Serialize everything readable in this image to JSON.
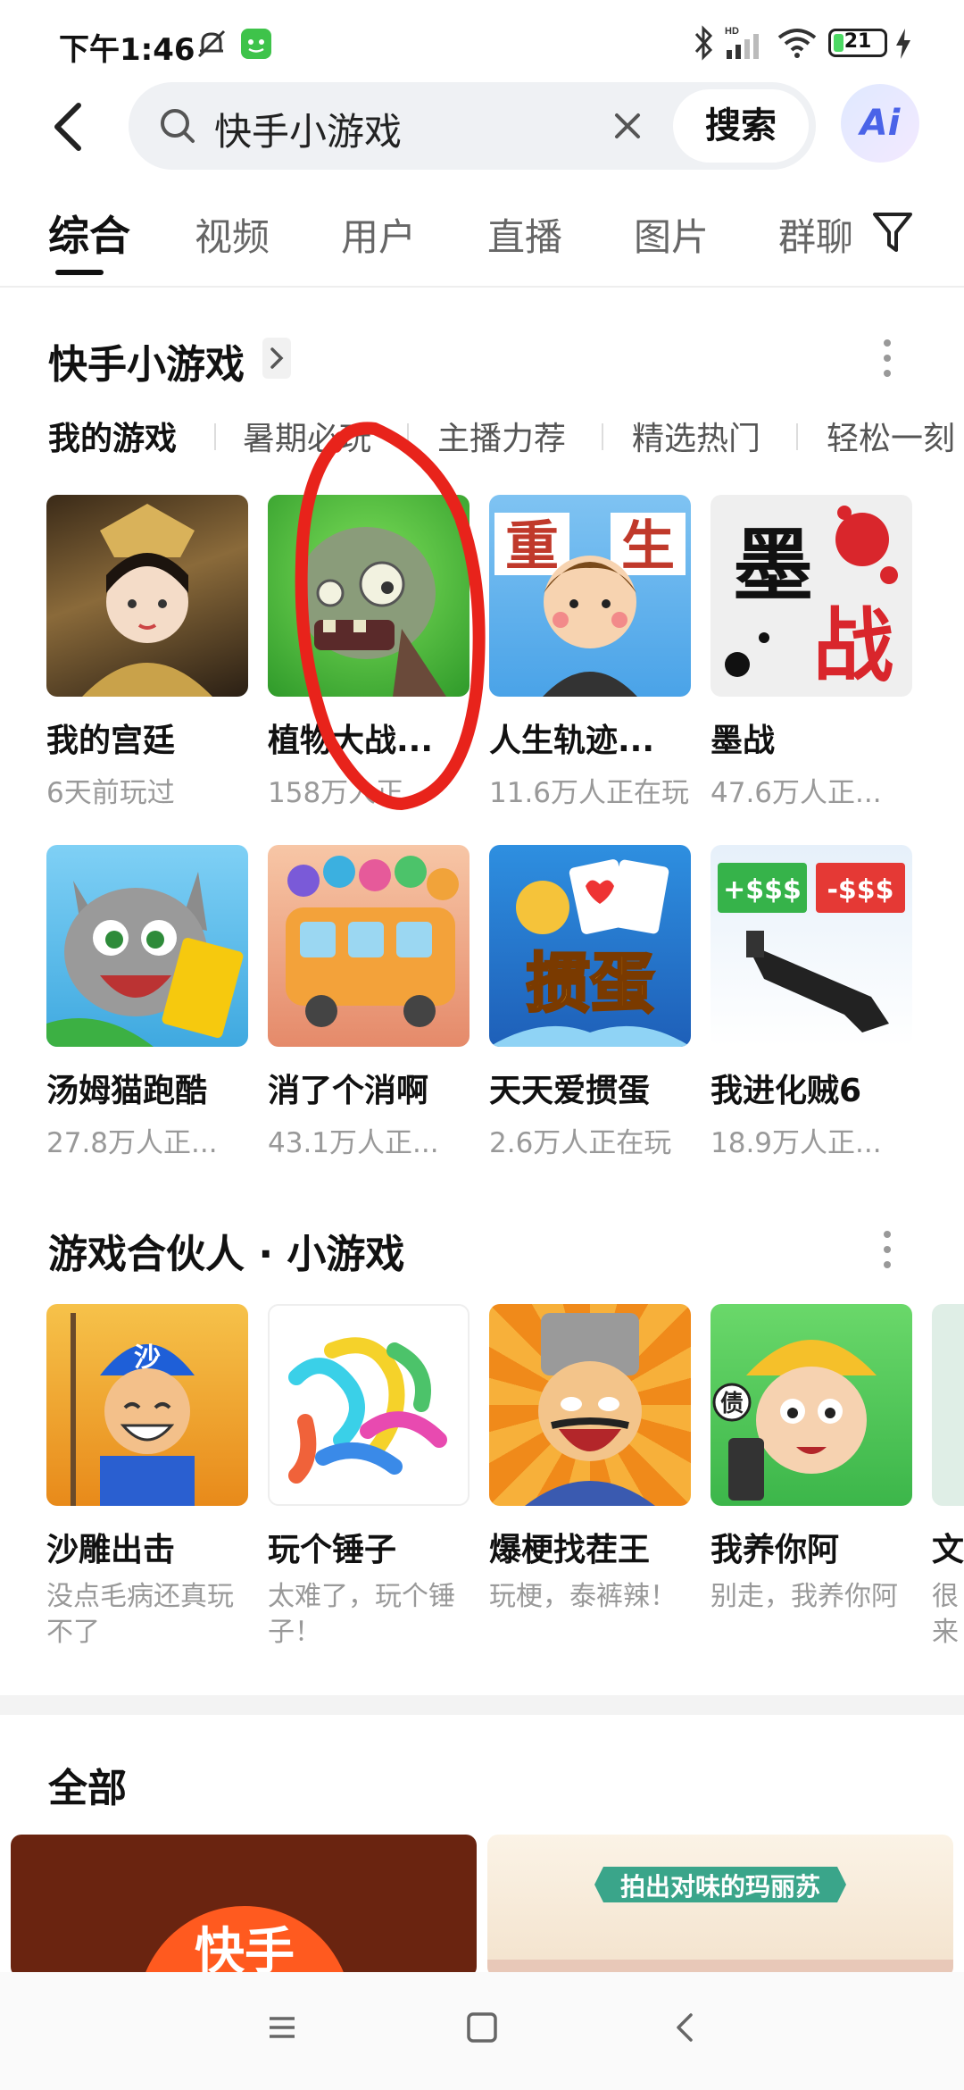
{
  "status_bar": {
    "time": "下午1:46",
    "battery": "21",
    "battery_level": 0.21
  },
  "search": {
    "query": "快手小游戏",
    "button_label": "搜索",
    "ai_label": "Ai"
  },
  "tabs": [
    {
      "label": "综合"
    },
    {
      "label": "视频"
    },
    {
      "label": "用户"
    },
    {
      "label": "直播"
    },
    {
      "label": "图片"
    },
    {
      "label": "群聊"
    }
  ],
  "section1": {
    "title": "快手小游戏",
    "subcategories": [
      "我的游戏",
      "暑期必玩",
      "主播力荐",
      "精选热门",
      "轻松一刻"
    ],
    "games": [
      {
        "name": "我的宫廷",
        "sub": "6天前玩过"
      },
      {
        "name": "植物大战...",
        "sub": "158万人正..."
      },
      {
        "name": "人生轨迹...",
        "sub": "11.6万人正在玩"
      },
      {
        "name": "墨战",
        "sub": "47.6万人正..."
      },
      {
        "name": "汤姆猫跑酷",
        "sub": "27.8万人正..."
      },
      {
        "name": "消了个消啊",
        "sub": "43.1万人正..."
      },
      {
        "name": "天天爱掼蛋",
        "sub": "2.6万人正在玩"
      },
      {
        "name": "我进化贼6",
        "sub": "18.9万人正..."
      }
    ]
  },
  "section2": {
    "title": "游戏合伙人 · 小游戏",
    "games": [
      {
        "name": "沙雕出击",
        "desc": "没点毛病还真玩不了"
      },
      {
        "name": "玩个锤子",
        "desc": "太难了，玩个锤子！"
      },
      {
        "name": "爆梗找茬王",
        "desc": "玩梗，泰裤辣！"
      },
      {
        "name": "我养你阿",
        "desc": "别走，我养你阿"
      },
      {
        "name": "文",
        "desc": "很来"
      }
    ],
    "tile_art_text": [
      "重",
      "生",
      "墨",
      "战",
      "掼蛋",
      "+$$$",
      "-$$$",
      "沙",
      "债"
    ]
  },
  "section3": {
    "title": "全部",
    "card_left_text": "快手",
    "card_right_banner": "拍出对味的玛丽苏"
  },
  "colors": {
    "annotation_red": "#e8231b",
    "kuaishou_orange": "#ff5a1f",
    "accent_blue": "#4a63e8"
  }
}
